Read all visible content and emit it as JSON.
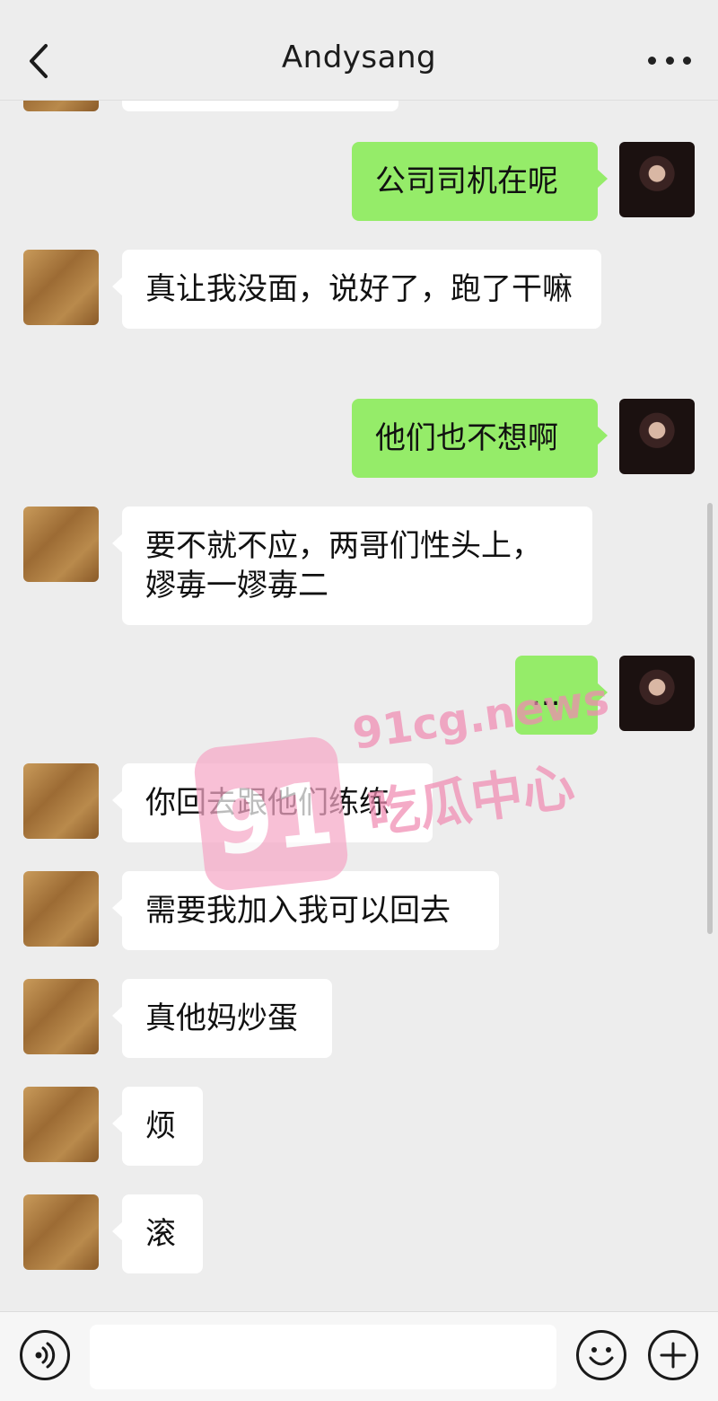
{
  "header": {
    "title": "Andysang",
    "back_icon": "chevron-left-icon",
    "more_icon": "more-dots-icon"
  },
  "messages": [
    {
      "from": "self",
      "text": "公司司机在呢"
    },
    {
      "from": "other",
      "text": "真让我没面，说好了，跑了干嘛"
    },
    {
      "from": "self",
      "text": "他们也不想啊"
    },
    {
      "from": "other",
      "text": "要不就不应，两哥们性头上，嫪毐一嫪毐二"
    },
    {
      "from": "self",
      "text": "..."
    },
    {
      "from": "other",
      "text": "你回去跟他们练练"
    },
    {
      "from": "other",
      "text": "需要我加入我可以回去"
    },
    {
      "from": "other",
      "text": "真他妈炒蛋"
    },
    {
      "from": "other",
      "text": "烦"
    },
    {
      "from": "other",
      "text": "滚"
    }
  ],
  "watermark": {
    "badge": "91",
    "domain": "91cg.news",
    "brand": "吃瓜中心"
  },
  "input_bar": {
    "voice_icon": "voice-icon",
    "emoji_icon": "emoji-icon",
    "plus_icon": "plus-icon",
    "value": ""
  },
  "colors": {
    "background": "#ededed",
    "outgoing_bubble": "#95ec69",
    "incoming_bubble": "#ffffff",
    "watermark": "#f08bb2"
  }
}
